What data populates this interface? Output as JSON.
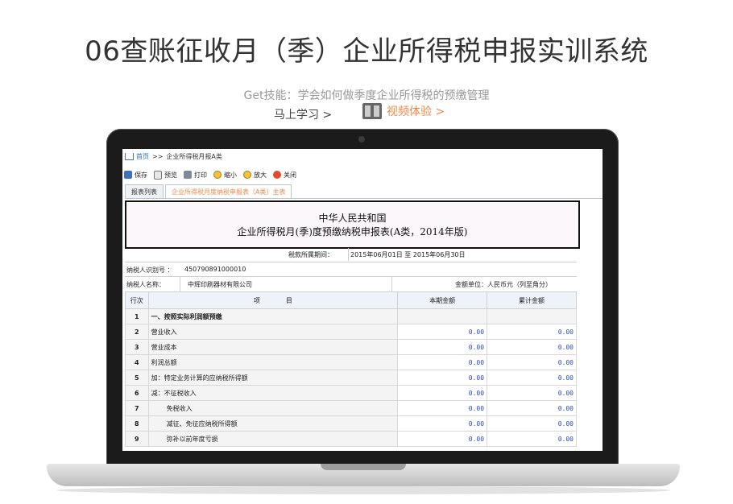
{
  "header": {
    "title": "06查账征收月（季）企业所得税申报实训系统",
    "subtitle": "Get技能：学会如何做季度企业所得税的预缴管理",
    "learn_link": "马上学习 >",
    "video_link": "视频体验 >"
  },
  "app": {
    "breadcrumb": {
      "home": "首页",
      "sep": ">>",
      "current": "企业所得税月报A类"
    },
    "toolbar": [
      "保存",
      "预览",
      "打印",
      "缩小",
      "放大",
      "关闭"
    ],
    "tabs": [
      "报表列表",
      "企业所得税月度纳税申报表（A类）主表"
    ],
    "form": {
      "title_line1": "中华人民共和国",
      "title_line2": "企业所得税月(季)度预缴纳税申报表(A类，2014年版)",
      "period_label": "税款所属期间：",
      "period_value": "2015年06月01日 至 2015年06月30日",
      "taxpayer_id_label": "纳税人识别号 ：",
      "taxpayer_id": "450790891000010",
      "taxpayer_name_label": "纳税人名称：",
      "taxpayer_name": "中辉印刷器材有限公司",
      "currency_unit": "金额单位：人民币元（列至角分）",
      "columns": [
        "行次",
        "项　　　　目",
        "本期金额",
        "累计金额"
      ],
      "rows": [
        {
          "no": "1",
          "item": "一、按照实际利润额预缴",
          "current": "",
          "cumulative": ""
        },
        {
          "no": "2",
          "item": "营业收入",
          "current": "0.00",
          "cumulative": "0.00"
        },
        {
          "no": "3",
          "item": "营业成本",
          "current": "0.00",
          "cumulative": "0.00"
        },
        {
          "no": "4",
          "item": "利润总额",
          "current": "0.00",
          "cumulative": "0.00"
        },
        {
          "no": "5",
          "item": "加：特定业务计算的应纳税所得额",
          "current": "0.00",
          "cumulative": "0.00"
        },
        {
          "no": "6",
          "item": "减：不征税收入",
          "current": "0.00",
          "cumulative": "0.00"
        },
        {
          "no": "7",
          "item": "免税收入",
          "current": "0.00",
          "cumulative": "0.00"
        },
        {
          "no": "8",
          "item": "减征、免征应纳税所得额",
          "current": "0.00",
          "cumulative": "0.00"
        },
        {
          "no": "9",
          "item": "弥补以前年度亏损",
          "current": "0.00",
          "cumulative": "0.00"
        }
      ]
    }
  }
}
